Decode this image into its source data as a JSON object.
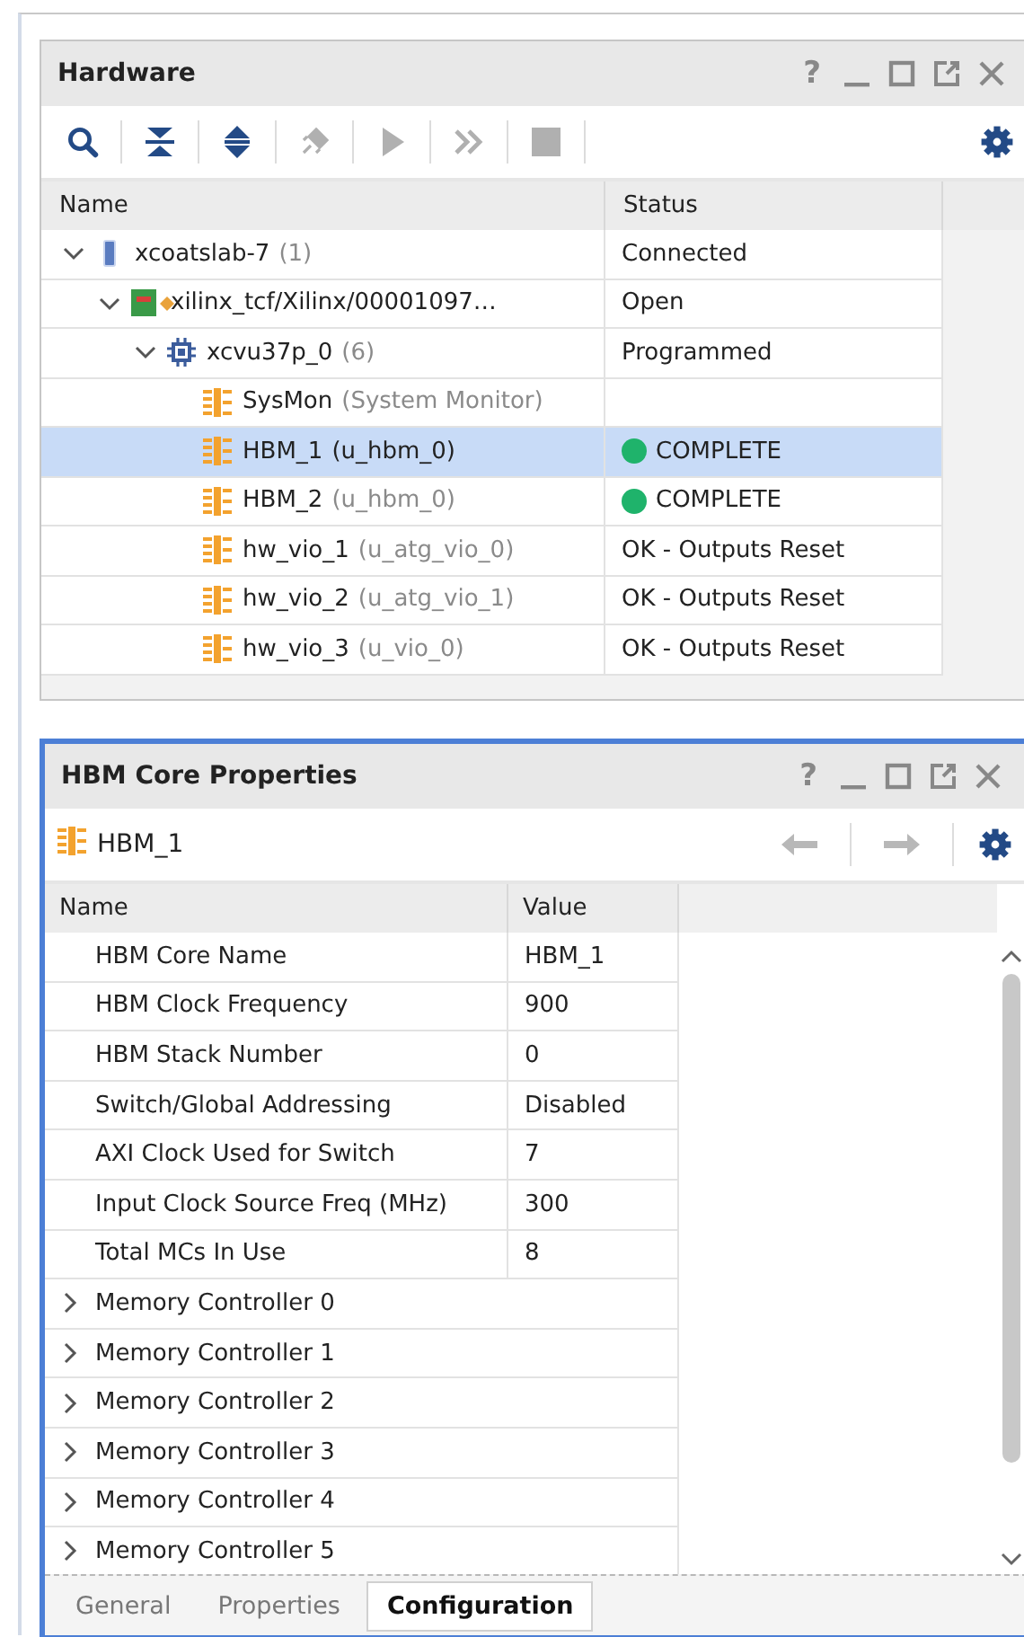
{
  "hardware": {
    "title": "Hardware",
    "help": "?",
    "toolbar": [
      {
        "kind": "search",
        "disabled": false
      },
      {
        "kind": "collapse",
        "disabled": false
      },
      {
        "kind": "expand",
        "disabled": false
      },
      {
        "kind": "connect",
        "disabled": true
      },
      {
        "kind": "run",
        "disabled": true
      },
      {
        "kind": "forward",
        "disabled": true
      },
      {
        "kind": "stop",
        "disabled": true
      }
    ],
    "columns": [
      "Name",
      "Status"
    ],
    "tree": [
      {
        "kind": "server",
        "name": "xcoatslab-7",
        "detail": "(1)",
        "status": "Connected",
        "expanded": true,
        "selected": false,
        "children": [
          {
            "kind": "board",
            "name": "xilinx_tcf/Xilinx/00001097…",
            "status": "Open",
            "expanded": true,
            "selected": false,
            "children": [
              {
                "kind": "chip",
                "name": "xcvu37p_0",
                "detail": "(6)",
                "status": "Programmed",
                "expanded": true,
                "selected": false,
                "children": [
                  {
                    "kind": "core",
                    "name": "SysMon",
                    "detail": "(System Monitor)",
                    "selected": false
                  },
                  {
                    "kind": "core",
                    "name": "HBM_1",
                    "detail": "(u_hbm_0)",
                    "status": "COMPLETE",
                    "color": "#1fb36b",
                    "selected": true
                  },
                  {
                    "kind": "core",
                    "name": "HBM_2",
                    "detail": "(u_hbm_0)",
                    "status": "COMPLETE",
                    "color": "#1fb36b",
                    "selected": false
                  },
                  {
                    "kind": "core",
                    "name": "hw_vio_1",
                    "detail": "(u_atg_vio_0)",
                    "status": "OK - Outputs Reset",
                    "selected": false
                  },
                  {
                    "kind": "core",
                    "name": "hw_vio_2",
                    "detail": "(u_atg_vio_1)",
                    "status": "OK - Outputs Reset",
                    "selected": false
                  },
                  {
                    "kind": "core",
                    "name": "hw_vio_3",
                    "detail": "(u_vio_0)",
                    "status": "OK - Outputs Reset",
                    "selected": false
                  }
                ]
              }
            ]
          }
        ]
      }
    ]
  },
  "properties": {
    "title": "HBM Core Properties",
    "help": "?",
    "object": "HBM_1",
    "nav": [
      {
        "kind": "back",
        "disabled": true
      },
      {
        "kind": "forward",
        "disabled": true
      }
    ],
    "columns": [
      "Name",
      "Value"
    ],
    "rows": [
      {
        "kind": "property",
        "name": "HBM Core Name",
        "value": "HBM_1"
      },
      {
        "kind": "property",
        "name": "HBM Clock Frequency",
        "value": "900"
      },
      {
        "kind": "property",
        "name": "HBM Stack Number",
        "value": "0"
      },
      {
        "kind": "property",
        "name": "Switch/Global Addressing",
        "value": "Disabled"
      },
      {
        "kind": "property",
        "name": "AXI Clock Used for Switch",
        "value": "7"
      },
      {
        "kind": "property",
        "name": "Input Clock Source Freq (MHz)",
        "value": "300"
      },
      {
        "kind": "property",
        "name": "Total MCs In Use",
        "value": "8"
      },
      {
        "kind": "group",
        "name": "Memory Controller 0",
        "expanded": false
      },
      {
        "kind": "group",
        "name": "Memory Controller 1",
        "expanded": false
      },
      {
        "kind": "group",
        "name": "Memory Controller 2",
        "expanded": false
      },
      {
        "kind": "group",
        "name": "Memory Controller 3",
        "expanded": false
      },
      {
        "kind": "group",
        "name": "Memory Controller 4",
        "expanded": false
      },
      {
        "kind": "group",
        "name": "Memory Controller 5",
        "expanded": false
      }
    ],
    "tabs": [
      {
        "label": "General",
        "selected": false
      },
      {
        "label": "Properties",
        "selected": false
      },
      {
        "label": "Configuration",
        "selected": true
      }
    ]
  }
}
